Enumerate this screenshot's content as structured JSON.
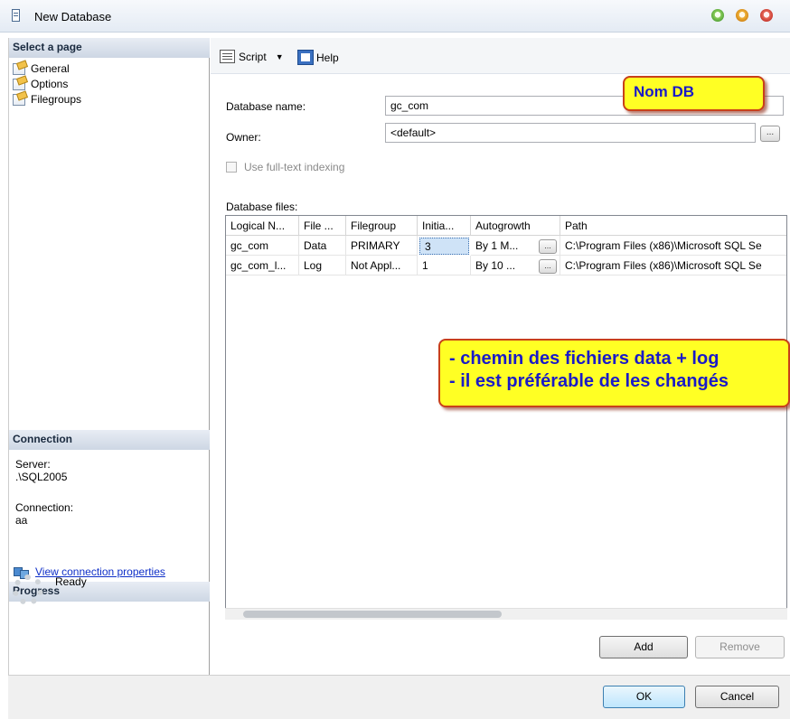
{
  "window": {
    "title": "New Database"
  },
  "left": {
    "select_header": "Select a page",
    "pages": [
      "General",
      "Options",
      "Filegroups"
    ],
    "connection_header": "Connection",
    "server_label": "Server:",
    "server_value": ".\\SQL2005",
    "connection_label": "Connection:",
    "connection_value": "aa",
    "view_link": "View connection properties",
    "progress_header": "Progress",
    "progress_status": "Ready"
  },
  "toolbar": {
    "script_label": "Script",
    "help_label": "Help"
  },
  "form": {
    "dbname_label": "Database name:",
    "dbname_value": "gc_com",
    "owner_label": "Owner:",
    "owner_value": "<default>",
    "ellipsis": "...",
    "fulltext_label": "Use full-text indexing",
    "dbfiles_label": "Database files:"
  },
  "grid": {
    "columns": [
      "Logical N...",
      "File ...",
      "Filegroup",
      "Initia...",
      "Autogrowth",
      "Path"
    ],
    "rows": [
      [
        "gc_com",
        "Data",
        "PRIMARY",
        "3",
        "By 1 M...",
        "C:\\Program Files (x86)\\Microsoft SQL Se"
      ],
      [
        "gc_com_l...",
        "Log",
        "Not Appl...",
        "1",
        "By 10 ...",
        "C:\\Program Files (x86)\\Microsoft SQL Se"
      ]
    ]
  },
  "buttons": {
    "add": "Add",
    "remove": "Remove",
    "ok": "OK",
    "cancel": "Cancel"
  },
  "annotations": {
    "nom_db": "Nom DB",
    "chemin_line1": "- chemin des fichiers data + log",
    "chemin_line2": "- il est préférable de les changés"
  },
  "colors": {
    "callout_fill": "#ffff24",
    "callout_border": "#c8401a",
    "callout_text": "#1a1ac8",
    "link": "#1030c8"
  }
}
